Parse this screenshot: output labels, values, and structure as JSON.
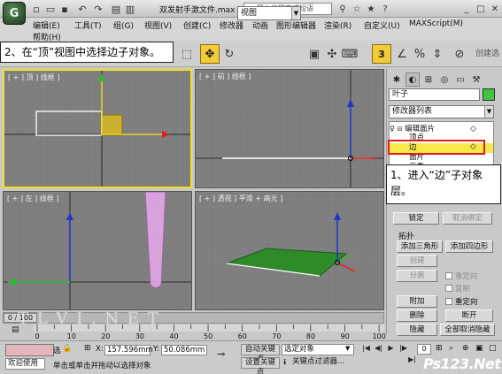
{
  "app": {
    "title": "双发射手激文件.max",
    "search_placeholder": "键入关键字或短语"
  },
  "menu": [
    {
      "label": "编辑(E)"
    },
    {
      "label": "工具(T)"
    },
    {
      "label": "组(G)"
    },
    {
      "label": "视图(V)"
    },
    {
      "label": "创建(C)"
    },
    {
      "label": "修改器"
    },
    {
      "label": "动画"
    },
    {
      "label": "图形编辑器"
    },
    {
      "label": "渲染(R)"
    },
    {
      "label": "自定义(U)"
    },
    {
      "label": "MAXScript(M)"
    },
    {
      "label": "帮助(H)"
    }
  ],
  "toolbar": {
    "view_select": "视图",
    "create_selection_label": "创建选",
    "snap_label": "3"
  },
  "callouts": {
    "step2": "2、在“顶”视图中选择边子对象。",
    "step1": "1、进入“边”子对象层。"
  },
  "viewports": {
    "top": "[ + ] 顶 ] 线框 ]",
    "front": "[ + ] 前 ] 线框 ]",
    "left": "[ + ] 左 ] 线框 ]",
    "perspective": "[ + ] 透视 ] 平滑 + 高光 ]"
  },
  "command_panel": {
    "object_name": "叶子",
    "object_color": "#3ec73e",
    "modifier_list": "修改器列表",
    "stack": {
      "modifier": "编辑面片",
      "sub_vertex": "顶点",
      "sub_edge": "边",
      "sub_patch": "面片",
      "sub_element": "元素"
    },
    "buttons": {
      "lock": "锁定",
      "unlock": "取消绑定",
      "add_tri": "添加三角形",
      "add_quad": "添加四边形",
      "create": "创建",
      "subdivide": "分离",
      "reorient": "重定向",
      "copy": "复制",
      "attach": "附加",
      "reorient2": "重定向",
      "delete": "删除",
      "break": "断开",
      "hide": "隐藏",
      "unhide_all": "全部取消隐藏"
    },
    "group_topology": "拓扑"
  },
  "timeline": {
    "slider": "0 / 100",
    "ticks": [
      "0",
      "10",
      "20",
      "30",
      "40",
      "50",
      "60",
      "70",
      "80",
      "90",
      "100"
    ]
  },
  "status": {
    "welcome": "欢迎使用",
    "selection": "选",
    "prompt": "单击或单击并拖动以选择对象",
    "x_label": "X:",
    "x_value": "157.596mm",
    "y_label": "Y:",
    "y_value": "50.086mm",
    "autokey": "自动关键点",
    "setkey": "设置关键点",
    "key_filter_select": "选定对象",
    "key_filter": "关键点过滤器...",
    "frame": "0"
  },
  "watermarks": {
    "tlvi": "T L V I . N E T",
    "ps123": "Ps123.Net"
  }
}
